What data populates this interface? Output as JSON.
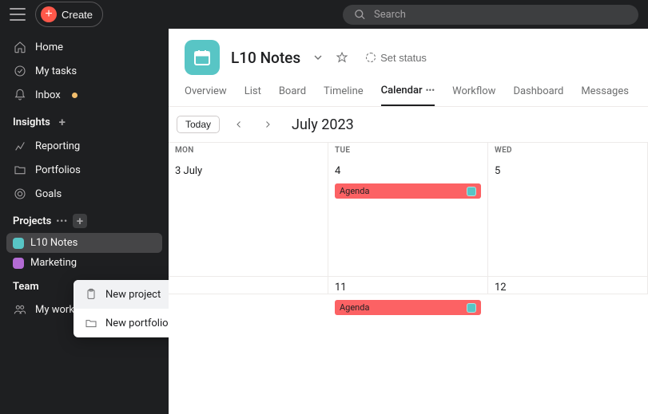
{
  "topbar": {
    "create_label": "Create",
    "search_placeholder": "Search"
  },
  "sidebar": {
    "nav": {
      "home": "Home",
      "my_tasks": "My tasks",
      "inbox": "Inbox"
    },
    "insights_header": "Insights",
    "insights": {
      "reporting": "Reporting",
      "portfolios": "Portfolios",
      "goals": "Goals"
    },
    "projects_header": "Projects",
    "projects": [
      {
        "name": "L10 Notes",
        "color": "#58c5c5"
      },
      {
        "name": "Marketing",
        "color": "#b36bd4"
      }
    ],
    "team_header": "Team",
    "team": {
      "workspace": "My workspace"
    }
  },
  "popover": {
    "new_project": "New project",
    "new_portfolio": "New portfolio"
  },
  "project": {
    "title": "L10 Notes",
    "set_status": "Set status",
    "tabs": [
      "Overview",
      "List",
      "Board",
      "Timeline",
      "Calendar",
      "Workflow",
      "Dashboard",
      "Messages"
    ],
    "active_tab": "Calendar"
  },
  "calendar": {
    "today_btn": "Today",
    "month_label": "July 2023",
    "dow": [
      "MON",
      "TUE",
      "WED"
    ],
    "cells": [
      {
        "label": "3 July",
        "events": []
      },
      {
        "label": "4",
        "events": [
          "Agenda"
        ]
      },
      {
        "label": "5",
        "events": []
      },
      {
        "label": "",
        "events": []
      },
      {
        "label": "11",
        "events": [
          "Agenda"
        ]
      },
      {
        "label": "12",
        "events": []
      }
    ]
  }
}
